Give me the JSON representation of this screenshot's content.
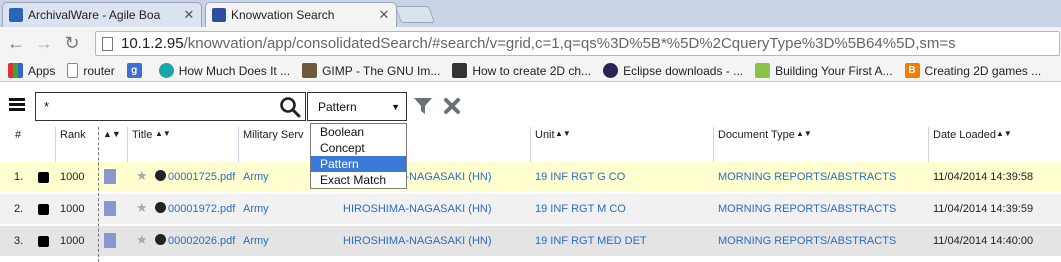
{
  "browser": {
    "tabs": [
      {
        "title": "ArchivalWare - Agile Boa",
        "active": false
      },
      {
        "title": "Knowvation Search",
        "active": true
      }
    ],
    "address": {
      "host": "10.1.2.95",
      "path": "/knowvation/app/consolidatedSearch/#search/v=grid,c=1,q=qs%3D%5B*%5D%2CqueryType%3D%5B64%5D,sm=s"
    },
    "bookmarks": [
      {
        "label": "Apps",
        "icon": "apps-icon"
      },
      {
        "label": "router",
        "icon": "page-icon"
      },
      {
        "label": "",
        "icon": "google-icon"
      },
      {
        "label": "How Much Does It ...",
        "icon": "site-icon"
      },
      {
        "label": "GIMP - The GNU Im...",
        "icon": "gimp-icon"
      },
      {
        "label": "How to create 2D ch...",
        "icon": "unity-icon"
      },
      {
        "label": "Eclipse downloads - ...",
        "icon": "eclipse-icon"
      },
      {
        "label": "Building Your First A...",
        "icon": "android-icon"
      },
      {
        "label": "Creating 2D games ...",
        "icon": "blogger-icon"
      }
    ]
  },
  "search": {
    "query": "*",
    "mode": "Pattern",
    "mode_options": [
      "Boolean",
      "Concept",
      "Pattern",
      "Exact Match"
    ]
  },
  "grid": {
    "headers": {
      "index": "#",
      "rank": "Rank",
      "title": "Title",
      "military": "Military Serv",
      "unit": "Unit",
      "doctype": "Document Type",
      "date": "Date Loaded"
    },
    "rows": [
      {
        "index": "1.",
        "rank": "1000",
        "title": "00001725.pdf",
        "military": "Army",
        "location": "HIROSHIMA-NAGASAKI (HN)",
        "unit": "19 INF RGT G CO",
        "doctype": "MORNING REPORTS/ABSTRACTS",
        "date": "11/04/2014 14:39:58"
      },
      {
        "index": "2.",
        "rank": "1000",
        "title": "00001972.pdf",
        "military": "Army",
        "location": "HIROSHIMA-NAGASAKI (HN)",
        "unit": "19 INF RGT M CO",
        "doctype": "MORNING REPORTS/ABSTRACTS",
        "date": "11/04/2014 14:39:59"
      },
      {
        "index": "3.",
        "rank": "1000",
        "title": "00002026.pdf",
        "military": "Army",
        "location": "HIROSHIMA-NAGASAKI (HN)",
        "unit": "19 INF RGT MED DET",
        "doctype": "MORNING REPORTS/ABSTRACTS",
        "date": "11/04/2014 14:40:00"
      }
    ]
  },
  "colors": {
    "link": "#2b6cc9",
    "highlight_row": "#ffffd0",
    "selected_option": "#3a79d8"
  }
}
